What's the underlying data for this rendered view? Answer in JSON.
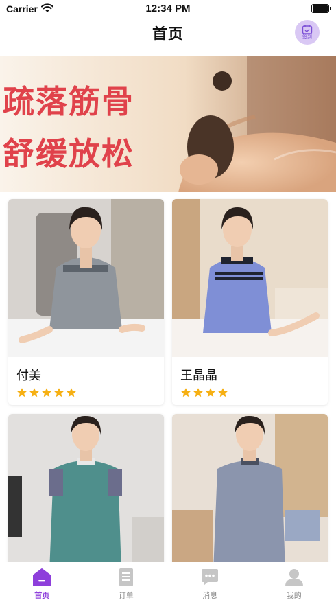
{
  "status_bar": {
    "carrier": "Carrier",
    "time": "12:34 PM"
  },
  "nav": {
    "title": "首页",
    "signin_label": "签到",
    "signin_icon": "calendar-check-icon"
  },
  "banner": {
    "line1": "疏落筋骨",
    "line2": "舒缓放松"
  },
  "staff": [
    {
      "name": "付美",
      "rating": 5,
      "uniform": "#8f959c",
      "collar": "#5c636b"
    },
    {
      "name": "王晶晶",
      "rating": 4,
      "uniform": "#7f8fd6",
      "collar": "#1f2430"
    },
    {
      "name": "",
      "rating": 0,
      "uniform": "#4f8f8c",
      "collar": "#e8e8e8"
    },
    {
      "name": "",
      "rating": 0,
      "uniform": "#8b95ad",
      "collar": "#4a5060"
    }
  ],
  "tabs": [
    {
      "label": "首页",
      "icon": "home-icon",
      "active": true
    },
    {
      "label": "订单",
      "icon": "order-list-icon",
      "active": false
    },
    {
      "label": "消息",
      "icon": "message-icon",
      "active": false
    },
    {
      "label": "我的",
      "icon": "profile-icon",
      "active": false
    }
  ],
  "colors": {
    "accent": "#8e3fdb",
    "banner_text": "#e0424b",
    "star": "#f6b014",
    "signin_bg": "#d9c8f4"
  }
}
